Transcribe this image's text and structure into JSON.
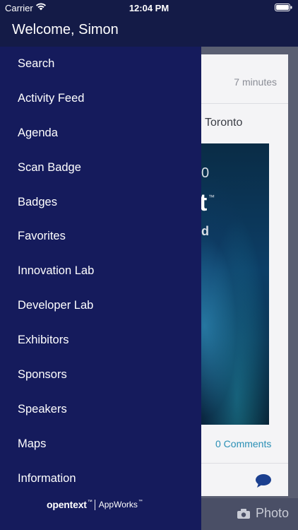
{
  "status_bar": {
    "carrier": "Carrier",
    "time": "12:04 PM"
  },
  "drawer": {
    "welcome": "Welcome, Simon",
    "items": [
      {
        "label": "Search"
      },
      {
        "label": "Activity Feed"
      },
      {
        "label": "Agenda"
      },
      {
        "label": "Scan Badge"
      },
      {
        "label": "Badges"
      },
      {
        "label": "Favorites"
      },
      {
        "label": "Innovation Lab"
      },
      {
        "label": "Developer Lab"
      },
      {
        "label": "Exhibitors"
      },
      {
        "label": "Sponsors"
      },
      {
        "label": "Speakers"
      },
      {
        "label": "Maps"
      },
      {
        "label": "Information"
      }
    ],
    "brand": {
      "name": "opentext",
      "tm": "™",
      "product": "AppWorks",
      "product_tm": "™"
    }
  },
  "background": {
    "time_ago": "7 minutes",
    "location": "Toronto",
    "comments": "0 Comments",
    "photo_label": "Photo",
    "logo_fragments": [
      "0",
      "t",
      "™",
      "d"
    ]
  },
  "colors": {
    "drawer_bg": "#151b5c",
    "header_bg": "#141b47",
    "link": "#2a8fb5"
  }
}
